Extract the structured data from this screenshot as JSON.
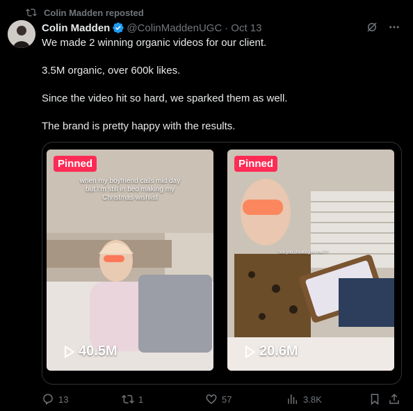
{
  "repost": {
    "label": "Colin Madden reposted"
  },
  "post": {
    "author_name": "Colin Madden",
    "handle": "@ColinMaddenUGC",
    "separator": "·",
    "date": "Oct 13",
    "paragraphs": [
      "We made 2 winning organic videos for our client.",
      "3.5M organic, over 600k likes.",
      "Since the video hit so hard, we sparked them as well.",
      "The brand is pretty happy with the results."
    ]
  },
  "media": [
    {
      "badge": "Pinned",
      "views": "40.5M",
      "caption": "when my boyfriend calls mid day but I'm still in bed making my Christmas wishlist"
    },
    {
      "badge": "Pinned",
      "views": "20.6M",
      "caption": "*are you cheating on me??*"
    }
  ],
  "actions": {
    "replies": "13",
    "reposts": "1",
    "likes": "57",
    "views": "3.8K"
  },
  "colors": {
    "accent": "#1d9bf0",
    "pinned": "#fe2c55",
    "muted": "#71767b",
    "text": "#e7e9ea",
    "background": "#000000"
  },
  "icons": [
    "repost-icon",
    "verified-badge-icon",
    "grok-icon",
    "more-icon",
    "play-icon",
    "reply-icon",
    "like-icon",
    "views-icon",
    "bookmark-icon",
    "share-icon"
  ]
}
